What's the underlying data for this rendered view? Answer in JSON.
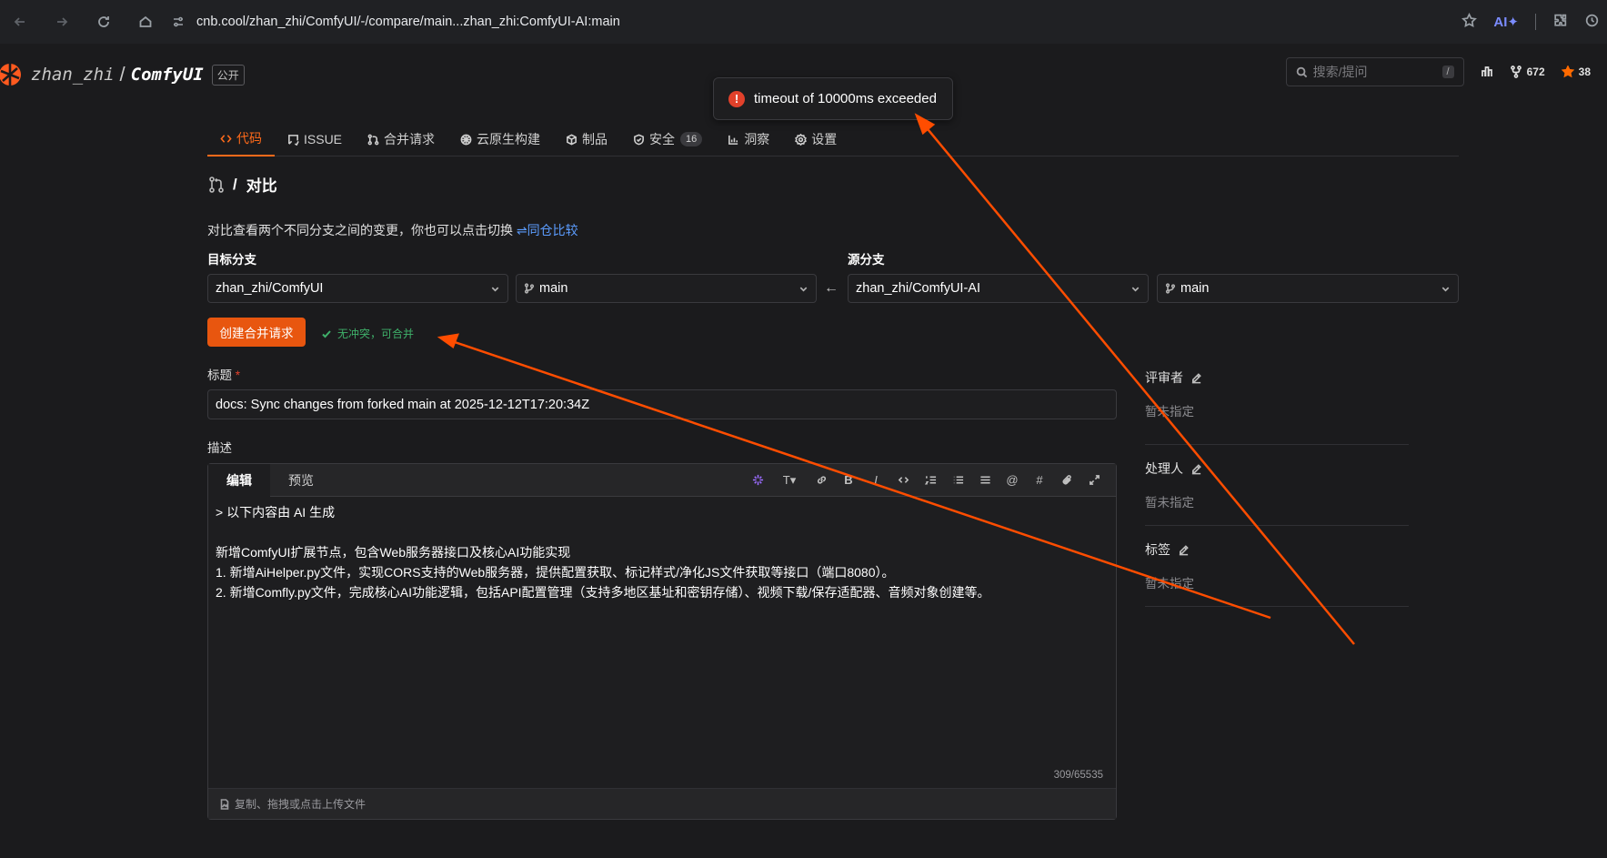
{
  "browser": {
    "url": "cnb.cool/zhan_zhi/ComfyUI/-/compare/main...zhan_zhi:ComfyUI-AI:main",
    "ai_label": "AI✦"
  },
  "repo": {
    "owner": "zhan_zhi",
    "name": "ComfyUI",
    "visibility": "公开",
    "search_placeholder": "搜索/提问",
    "search_key": "/",
    "forks": "672",
    "stars": "38"
  },
  "toast": {
    "message": "timeout of 10000ms exceeded"
  },
  "tabs": [
    {
      "label": "代码",
      "icon": "code-icon"
    },
    {
      "label": "ISSUE",
      "icon": "issue-icon"
    },
    {
      "label": "合并请求",
      "icon": "merge-icon"
    },
    {
      "label": "云原生构建",
      "icon": "build-icon"
    },
    {
      "label": "制品",
      "icon": "package-icon"
    },
    {
      "label": "安全",
      "icon": "shield-icon",
      "count": "16"
    },
    {
      "label": "洞察",
      "icon": "chart-icon"
    },
    {
      "label": "设置",
      "icon": "gear-icon"
    }
  ],
  "compare": {
    "title": "对比",
    "description": "对比查看两个不同分支之间的变更，你也可以点击切换",
    "switch_link": "⇌同仓比较",
    "target_label": "目标分支",
    "source_label": "源分支",
    "target_repo": "zhan_zhi/ComfyUI",
    "target_branch": "main",
    "source_repo": "zhan_zhi/ComfyUI-AI",
    "source_branch": "main",
    "create_button": "创建合并请求",
    "status": "无冲突，可合并"
  },
  "form": {
    "title_label": "标题",
    "required_mark": "*",
    "title_value": "docs: Sync changes from forked main at 2025-12-12T17:20:34Z",
    "desc_label": "描述",
    "editor_tab_edit": "编辑",
    "editor_tab_preview": "预览",
    "body_lines": [
      "> 以下内容由 AI 生成",
      "",
      "新增ComfyUI扩展节点，包含Web服务器接口及核心AI功能实现",
      "1. 新增AiHelper.py文件，实现CORS支持的Web服务器，提供配置获取、标记样式/净化JS文件获取等接口（端口8080）。",
      "2. 新增Comfly.py文件，完成核心AI功能逻辑，包括API配置管理（支持多地区基址和密钥存储）、视频下载/保存适配器、音频对象创建等。"
    ],
    "char_count": "309/65535",
    "upload_hint": "复制、拖拽或点击上传文件"
  },
  "sidebar": {
    "reviewers_label": "评审者",
    "reviewers_value": "暂未指定",
    "assignee_label": "处理人",
    "assignee_value": "暂未指定",
    "labels_label": "标签",
    "labels_value": "暂未指定"
  },
  "colors": {
    "accent": "#ff6a1a",
    "button": "#e8560f",
    "success": "#3fb06a",
    "error": "#e2412b",
    "link": "#5c9dff",
    "annotation_arrow": "#ff4d00"
  }
}
